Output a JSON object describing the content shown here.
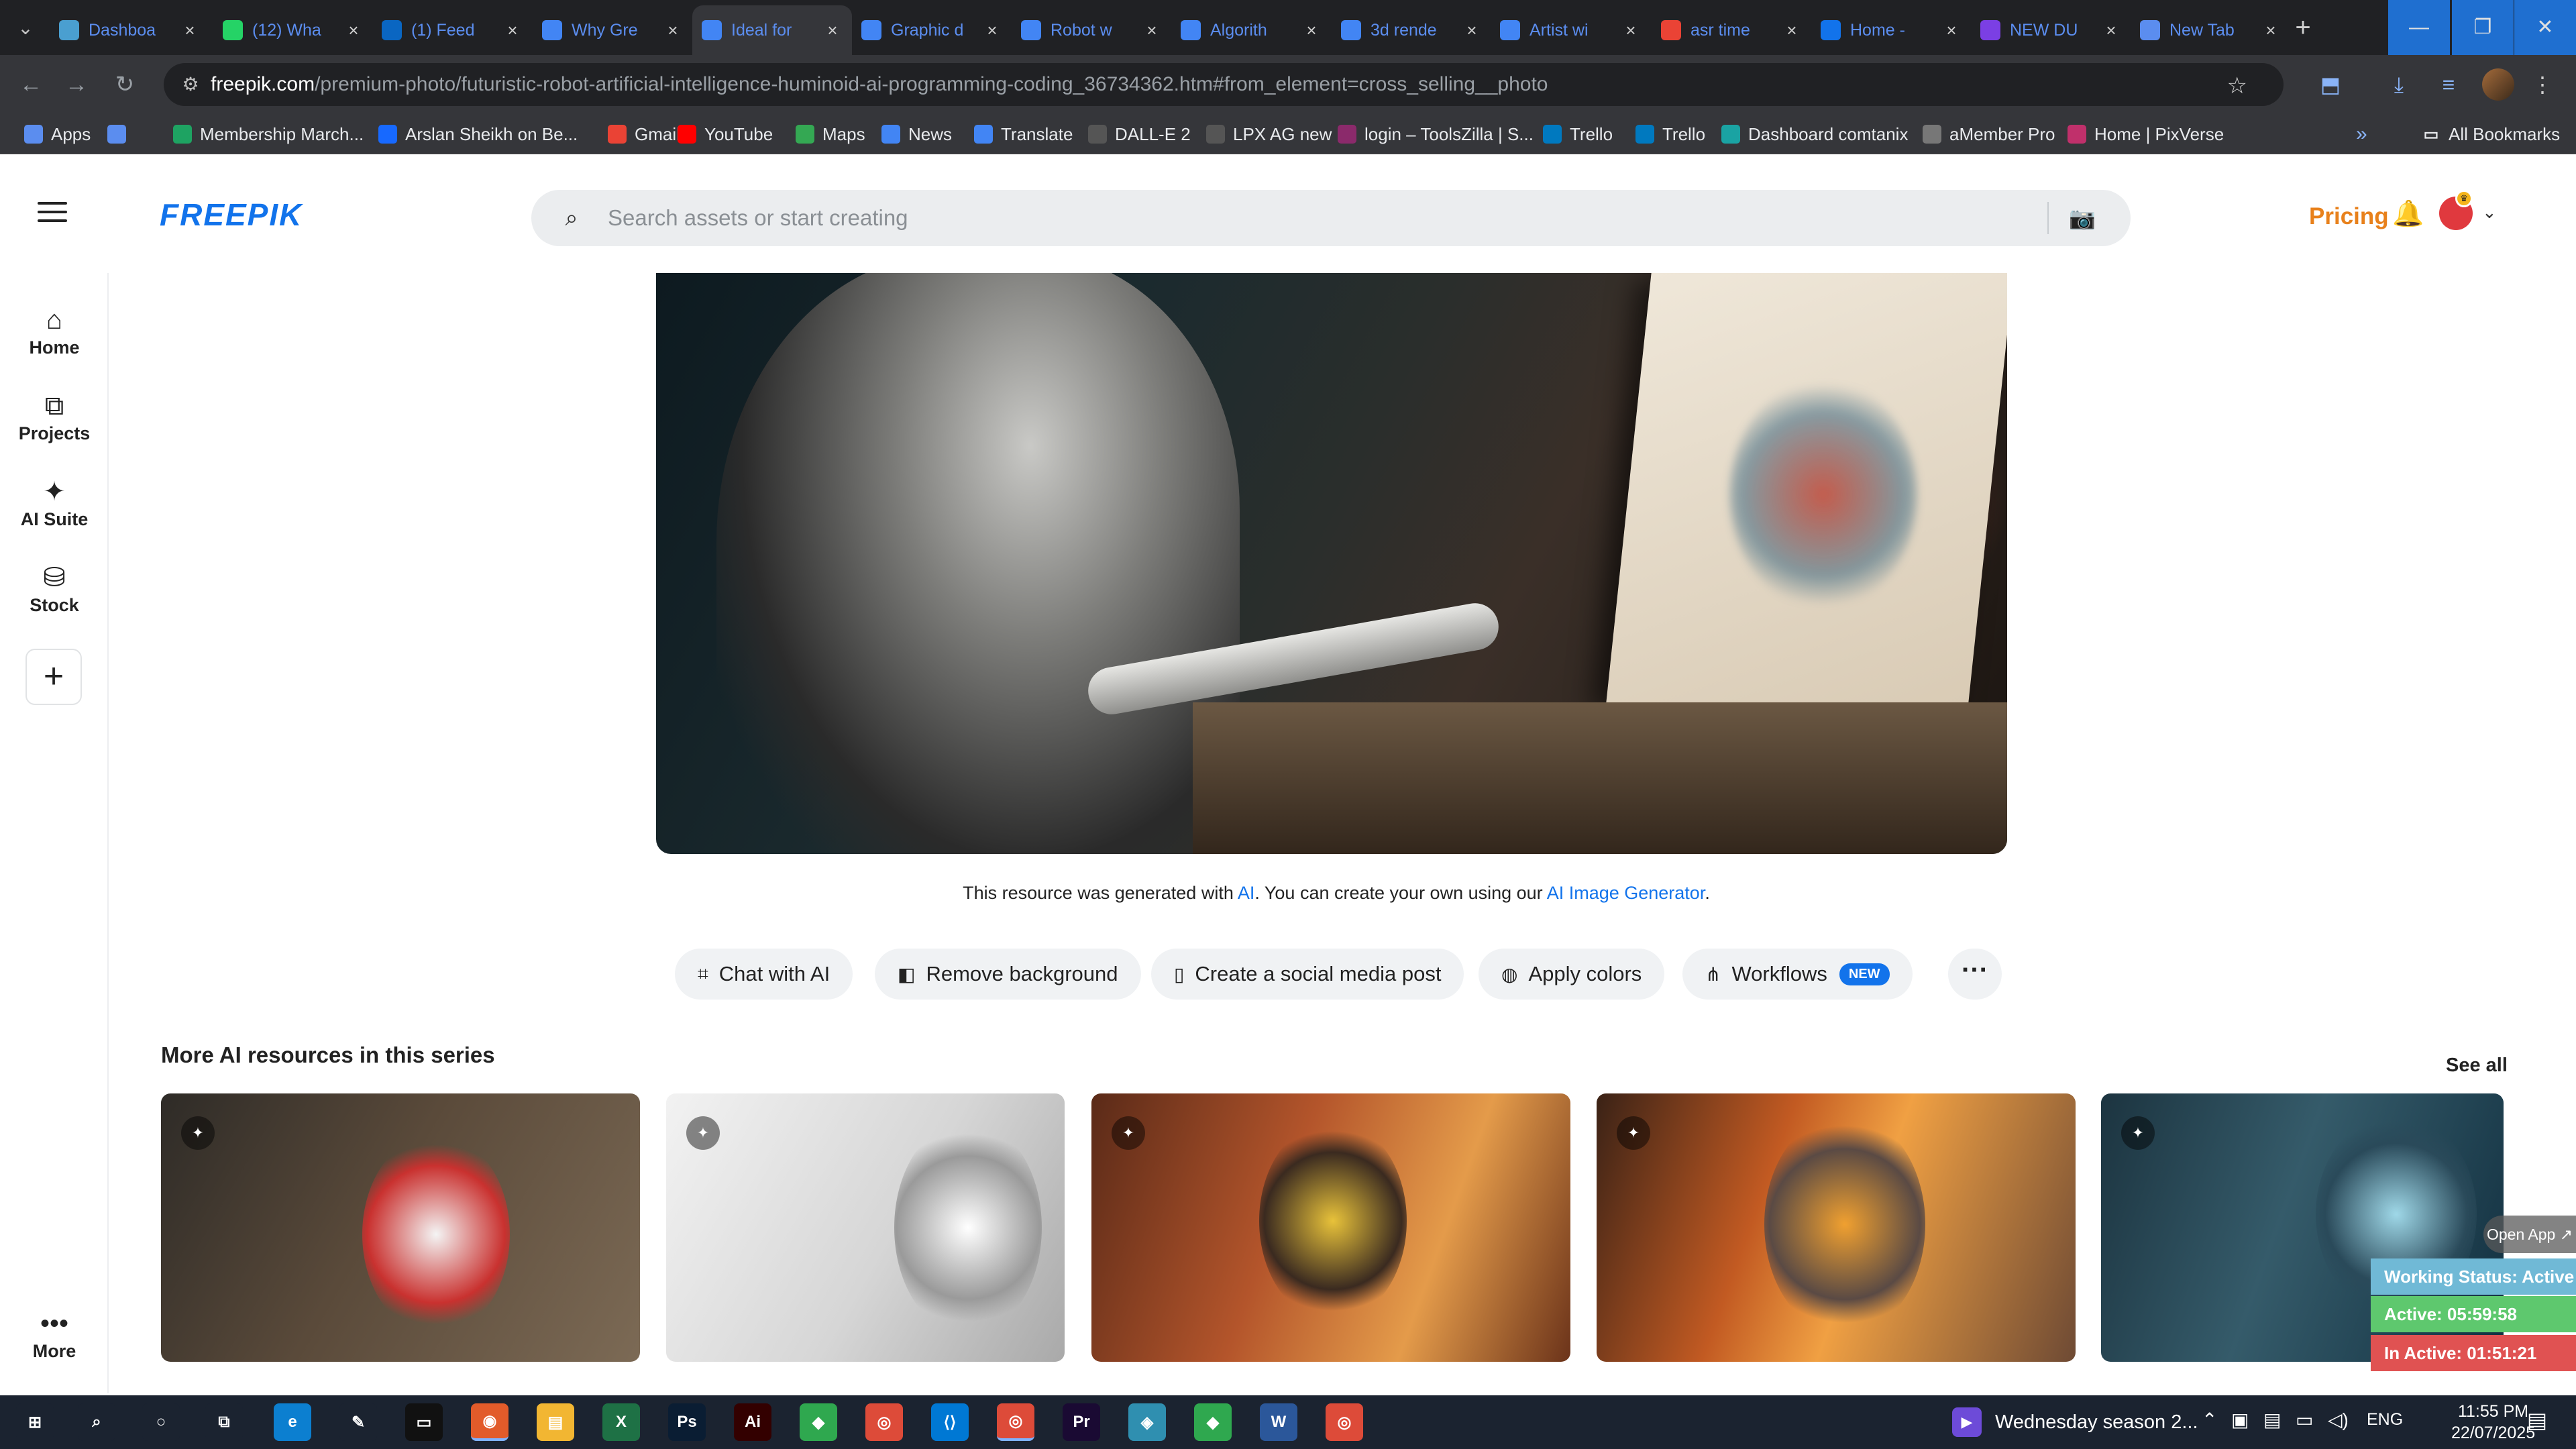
{
  "browser": {
    "tabs": [
      {
        "title": "Dashboa",
        "icon": "wordpress-icon",
        "color": "#4a9fd0"
      },
      {
        "title": "(12) Wha",
        "icon": "whatsapp-icon",
        "color": "#25d366"
      },
      {
        "title": "(1) Feed",
        "icon": "linkedin-icon",
        "color": "#0a66c2"
      },
      {
        "title": "Why Gre",
        "icon": "doc-icon",
        "color": "#4285f4"
      },
      {
        "title": "Ideal for",
        "icon": "doc-icon",
        "color": "#4285f4"
      },
      {
        "title": "Graphic d",
        "icon": "doc-icon",
        "color": "#4285f4"
      },
      {
        "title": "Robot w",
        "icon": "doc-icon",
        "color": "#4285f4"
      },
      {
        "title": "Algorith",
        "icon": "doc-icon",
        "color": "#4285f4"
      },
      {
        "title": "3d rende",
        "icon": "doc-icon",
        "color": "#4285f4"
      },
      {
        "title": "Artist wi",
        "icon": "doc-icon",
        "color": "#4285f4"
      },
      {
        "title": "asr time",
        "icon": "google-icon",
        "color": "#ea4335"
      },
      {
        "title": "Home - ",
        "icon": "site-icon",
        "color": "#1273eb"
      },
      {
        "title": "NEW DU",
        "icon": "video-icon",
        "color": "#7b3fe4"
      },
      {
        "title": "New Tab",
        "icon": "chrome-icon",
        "color": "#5b8def"
      }
    ],
    "url_host": "freepik.com",
    "url_path": "/premium-photo/futuristic-robot-artificial-intelligence-huminoid-ai-programming-coding_36734362.htm#from_element=cross_selling__photo",
    "bookmarks": [
      {
        "label": "Apps",
        "icon": "apps-grid-icon",
        "color": "#5b8def"
      },
      {
        "label": "",
        "icon": "tiles-icon",
        "color": "#5b8def"
      },
      {
        "label": "Membership March...",
        "icon": "plus-square-icon",
        "color": "#1ea362"
      },
      {
        "label": "Arslan Sheikh on Be...",
        "icon": "behance-icon",
        "color": "#1769ff"
      },
      {
        "label": "Gmail",
        "icon": "gmail-icon",
        "color": "#ea4335"
      },
      {
        "label": "YouTube",
        "icon": "youtube-icon",
        "color": "#ff0000"
      },
      {
        "label": "Maps",
        "icon": "maps-icon",
        "color": "#34a853"
      },
      {
        "label": "News",
        "icon": "news-icon",
        "color": "#4285f4"
      },
      {
        "label": "Translate",
        "icon": "translate-icon",
        "color": "#4285f4"
      },
      {
        "label": "DALL-E 2",
        "icon": "openai-icon",
        "color": "#555555"
      },
      {
        "label": "LPX AG new",
        "icon": "dash-icon",
        "color": "#555555"
      },
      {
        "label": "login – ToolsZilla | S...",
        "icon": "toolszilla-icon",
        "color": "#8b2a6b"
      },
      {
        "label": "Trello",
        "icon": "trello-icon",
        "color": "#0079bf"
      },
      {
        "label": "Trello",
        "icon": "trello-icon",
        "color": "#0079bf"
      },
      {
        "label": "Dashboard comtanix",
        "icon": "site-icon",
        "color": "#1aa3a3"
      },
      {
        "label": "aMember Pro",
        "icon": "amember-icon",
        "color": "#777777"
      },
      {
        "label": "Home | PixVerse",
        "icon": "pixverse-icon",
        "color": "#c0306b"
      }
    ],
    "all_bookmarks": "All Bookmarks"
  },
  "header": {
    "logo": "FREEPIK",
    "search_placeholder": "Search assets or start creating",
    "pricing": "Pricing"
  },
  "rail": {
    "items": [
      {
        "label": "Home",
        "icon": "home-icon"
      },
      {
        "label": "Projects",
        "icon": "projects-icon"
      },
      {
        "label": "AI Suite",
        "icon": "sparkles-icon"
      },
      {
        "label": "Stock",
        "icon": "stock-icon"
      }
    ],
    "more": "More"
  },
  "resource": {
    "note_prefix": "This resource was generated with",
    "note_ai": "AI",
    "note_middle": ". You can create your own using our",
    "note_link": "AI Image Generator",
    "note_suffix": "."
  },
  "actions": [
    {
      "label": "Chat with AI",
      "icon": "chat-ai-icon"
    },
    {
      "label": "Remove background",
      "icon": "remove-bg-icon"
    },
    {
      "label": "Create a social media post",
      "icon": "phone-icon"
    },
    {
      "label": "Apply colors",
      "icon": "palette-icon"
    },
    {
      "label": "Workflows",
      "icon": "workflow-icon",
      "badge": "NEW"
    }
  ],
  "series": {
    "title": "More AI resources in this series",
    "see_all": "See all"
  },
  "overlay": {
    "open_app": "Open App ↗",
    "status_label": "Working Status:",
    "status_value": "Active",
    "active": "Active: 05:59:58",
    "inactive": "In Active: 01:51:21"
  },
  "taskbar": {
    "media_title": "Wednesday season 2...",
    "lang": "ENG",
    "time": "11:55 PM",
    "date": "22/07/2025",
    "apps": [
      {
        "icon": "windows-start-icon",
        "color": "#1b2330",
        "label": "⊞"
      },
      {
        "icon": "search-icon",
        "color": "#1b2330",
        "label": "⌕"
      },
      {
        "icon": "cortana-icon",
        "color": "#1b2330",
        "label": "○"
      },
      {
        "icon": "task-view-icon",
        "color": "#1b2330",
        "label": "⧉"
      },
      {
        "icon": "edge-icon",
        "color": "#0c7fd0",
        "label": "e"
      },
      {
        "icon": "pen-icon",
        "color": "#1b2330",
        "label": "✎"
      },
      {
        "icon": "terminal-icon",
        "color": "#111111",
        "label": "▭"
      },
      {
        "icon": "app-icon",
        "color": "#e25b2a",
        "label": "◉"
      },
      {
        "icon": "file-explorer-icon",
        "color": "#f2b632",
        "label": "▤"
      },
      {
        "icon": "excel-icon",
        "color": "#1e7145",
        "label": "X"
      },
      {
        "icon": "photoshop-icon",
        "color": "#0a1d33",
        "label": "Ps"
      },
      {
        "icon": "illustrator-icon",
        "color": "#330000",
        "label": "Ai"
      },
      {
        "icon": "green-app-icon",
        "color": "#2fa84f",
        "label": "◆"
      },
      {
        "icon": "chrome-icon",
        "color": "#dd4b39",
        "label": "◎"
      },
      {
        "icon": "vscode-icon",
        "color": "#0078d4",
        "label": "⟨⟩"
      },
      {
        "icon": "chrome-icon",
        "color": "#dd4b39",
        "label": "◎"
      },
      {
        "icon": "premiere-icon",
        "color": "#1a0a33",
        "label": "Pr"
      },
      {
        "icon": "app-icon",
        "color": "#2f8fb0",
        "label": "◈"
      },
      {
        "icon": "green-app-icon",
        "color": "#2fa84f",
        "label": "◆"
      },
      {
        "icon": "word-icon",
        "color": "#2b579a",
        "label": "W"
      },
      {
        "icon": "chrome-icon",
        "color": "#dd4b39",
        "label": "◎"
      }
    ]
  }
}
